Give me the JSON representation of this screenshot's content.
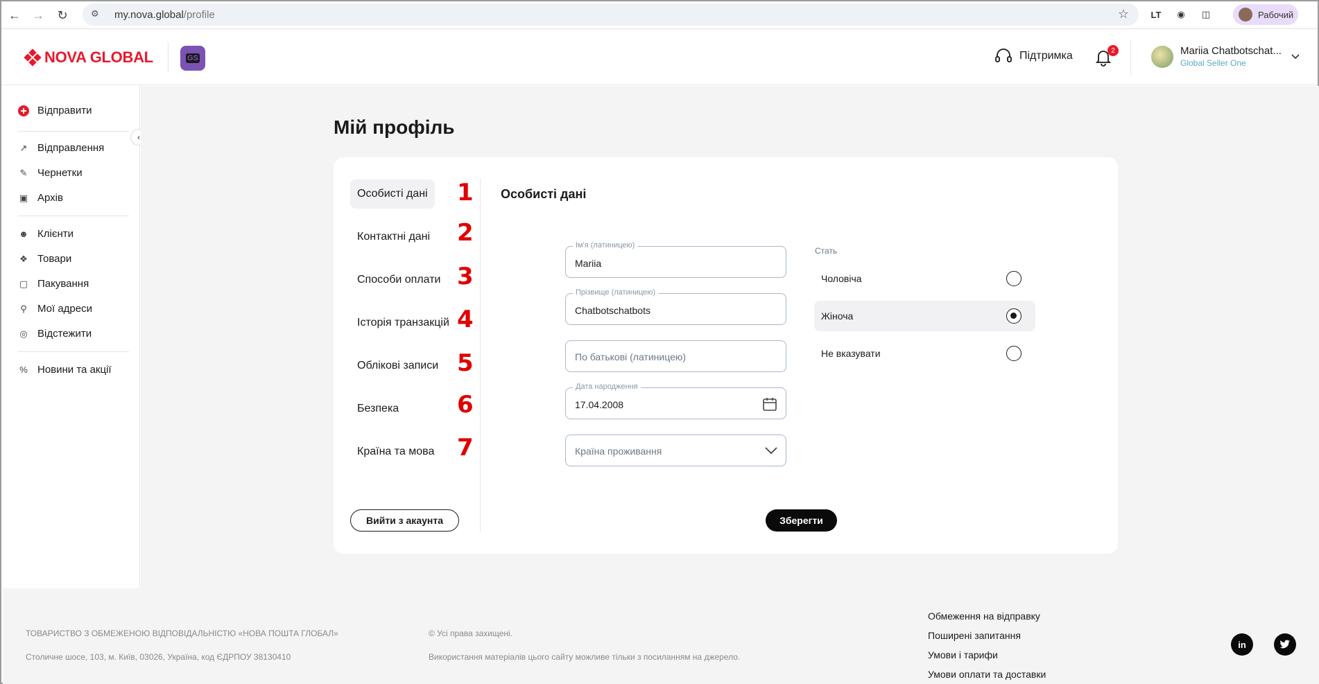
{
  "browser": {
    "url_host": "my.nova.global",
    "url_path": "/profile",
    "profile_label": "Рабочий"
  },
  "header": {
    "logo_text": "NOVA GLOBAL",
    "badge_text": "GS",
    "support_label": "Підтримка",
    "notifications_count": "2",
    "user_name": "Mariia Chatbotschat...",
    "user_role": "Global Seller One"
  },
  "sidebar": {
    "send_label": "Відправити",
    "items": [
      {
        "label": "Відправлення",
        "icon": "arrow-up-right-icon"
      },
      {
        "label": "Чернетки",
        "icon": "edit-icon"
      },
      {
        "label": "Архів",
        "icon": "archive-icon"
      },
      {
        "label": "Клієнти",
        "icon": "users-icon"
      },
      {
        "label": "Товари",
        "icon": "tag-icon"
      },
      {
        "label": "Пакування",
        "icon": "box-icon"
      },
      {
        "label": "Мої адреси",
        "icon": "address-icon"
      },
      {
        "label": "Відстежити",
        "icon": "target-icon"
      },
      {
        "label": "Новини та акції",
        "icon": "percent-icon"
      }
    ]
  },
  "page": {
    "title": "Мій профіль",
    "tabs": [
      {
        "label": "Особисті дані",
        "num": "1"
      },
      {
        "label": "Контактні дані",
        "num": "2"
      },
      {
        "label": "Способи оплати",
        "num": "3"
      },
      {
        "label": "Історія транзакцій",
        "num": "4"
      },
      {
        "label": "Облікові записи",
        "num": "5"
      },
      {
        "label": "Безпека",
        "num": "6"
      },
      {
        "label": "Країна та мова",
        "num": "7"
      }
    ],
    "logout_label": "Вийти з акаунта",
    "section_title": "Особисті дані",
    "form": {
      "first_name_label": "Ім'я (латиницею)",
      "first_name_value": "Mariia",
      "last_name_label": "Прізвище (латиницею)",
      "last_name_value": "Chatbotschatbots",
      "patronymic_placeholder": "По батькові (латиницею)",
      "birth_label": "Дата народження",
      "birth_value": "17.04.2008",
      "country_placeholder": "Країна проживання"
    },
    "gender": {
      "label": "Стать",
      "options": [
        "Чоловіча",
        "Жіноча",
        "Не вказувати"
      ],
      "selected": "Жіноча"
    },
    "save_label": "Зберегти"
  },
  "footer": {
    "company": "ТОВАРИСТВО З ОБМЕЖЕНОЮ ВІДПОВІДАЛЬНІСТЮ «НОВА ПОШТА ГЛОБАЛ»",
    "address": "Столичне шосе, 103, м. Київ, 03026, Україна, код ЄДРПОУ 38130410",
    "rights": "© Усі права захищені.",
    "usage": "Використання матеріалів цього сайту можливе тільки з посиланням на джерело.",
    "links": [
      "Обмеження на відправку",
      "Поширені запитання",
      "Умови і тарифи",
      "Умови оплати та доставки"
    ],
    "social_linkedin": "in"
  },
  "colors": {
    "brand": "#e8192c",
    "accent": "#7a53b3"
  }
}
